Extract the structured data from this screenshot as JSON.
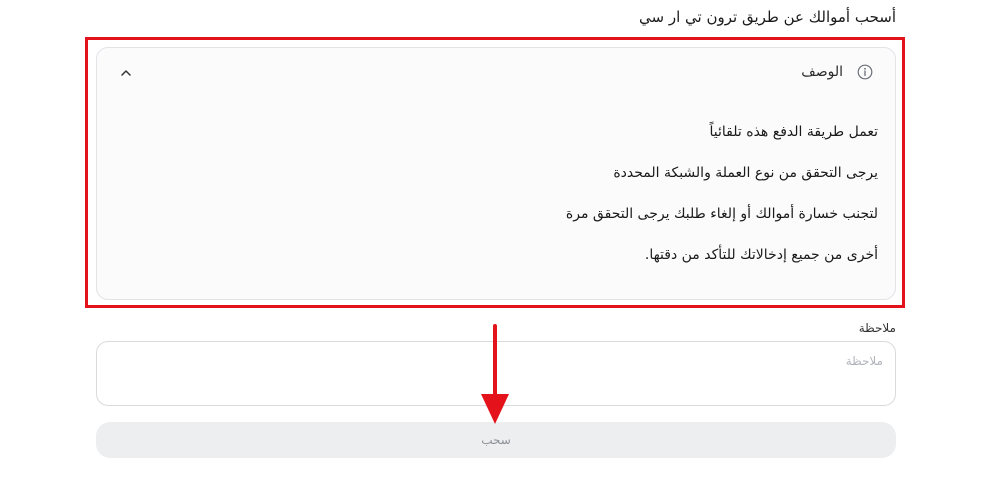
{
  "heading": "أسحب أموالك عن طريق ترون تي ار سي",
  "description": {
    "title": "الوصف",
    "icon": "info-icon",
    "toggle_icon": "chevron-up-icon",
    "lines": [
      "تعمل طريقة الدفع هذه تلقائياً",
      "يرجى التحقق من نوع العملة والشبكة المحددة",
      "لتجنب خسارة أموالك أو إلغاء طلبك يرجى التحقق مرة",
      "أخرى من جميع إدخالاتك للتأكد من دقتها."
    ]
  },
  "note": {
    "label": "ملاحظة",
    "placeholder": "ملاحظة",
    "value": ""
  },
  "submit": {
    "label": "سحب"
  },
  "colors": {
    "highlight": "#e3121b",
    "button_bg": "#eceef0",
    "button_text": "#8d9298"
  }
}
